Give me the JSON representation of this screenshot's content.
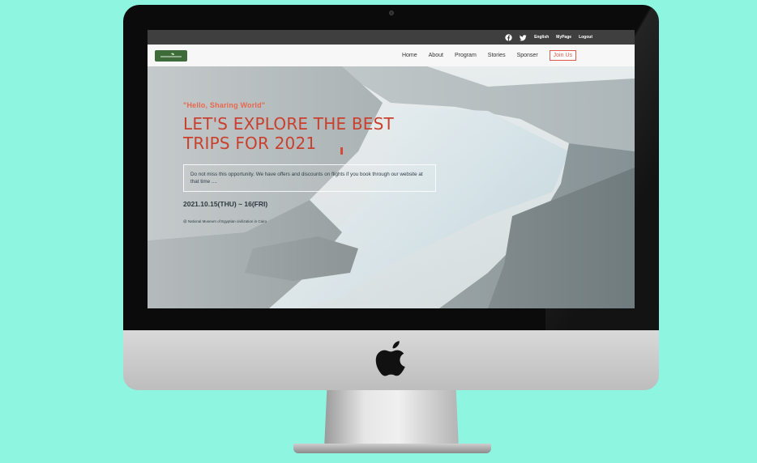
{
  "device": {
    "stand_logo_icon": "apple-logo-icon"
  },
  "colors": {
    "background": "#8ef5e1",
    "accent": "#c9402e",
    "tagline": "#e8674f",
    "topbar": "#3f3f3f",
    "logo_green": "#3e6b3a"
  },
  "site": {
    "topbar": {
      "icons": [
        "facebook-icon",
        "twitter-icon"
      ],
      "links": [
        "English",
        "MyPage",
        "Logout"
      ]
    },
    "nav": {
      "logo_alt": "sharing world logo",
      "items": [
        "Home",
        "About",
        "Program",
        "Stories",
        "Sponser"
      ],
      "cta": "Join Us"
    },
    "hero": {
      "tagline": "\"Hello, Sharing World\"",
      "headline_line1": "LET'S EXPLORE THE BEST",
      "headline_line2": "TRIPS FOR 2021",
      "description": "Do not miss this opportunity. We have offers and discounts on flights if you book through our website at that time ....",
      "date": "2021.10.15(THU) ~ 16(FRI)",
      "venue": "@ National Museum of Egyptian civilization in Cairo"
    }
  }
}
